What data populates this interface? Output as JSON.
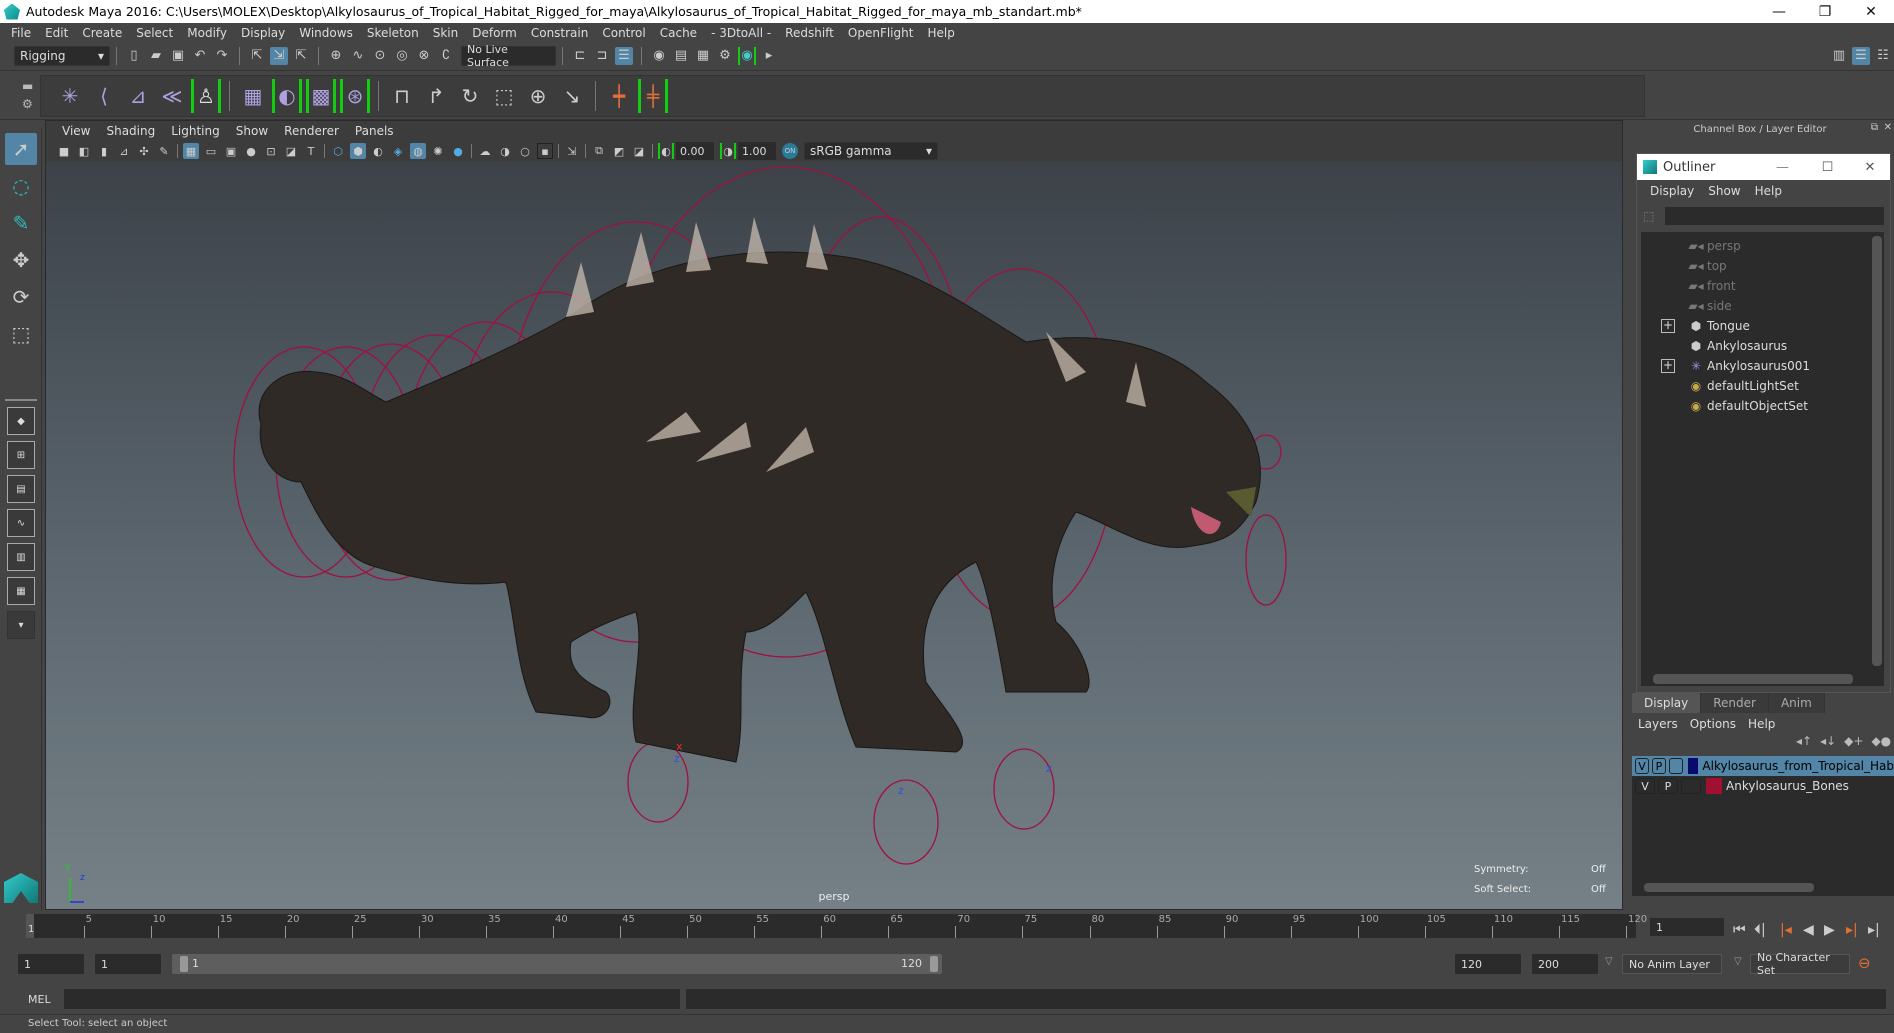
{
  "window": {
    "title": "Autodesk Maya 2016: C:\\Users\\MOLEX\\Desktop\\Alkylosaurus_of_Tropical_Habitat_Rigged_for_maya\\Alkylosaurus_of_Tropical_Habitat_Rigged_for_maya_mb_standart.mb*",
    "minimize": "—",
    "restore": "❐",
    "close": "✕"
  },
  "menubar": [
    "File",
    "Edit",
    "Create",
    "Select",
    "Modify",
    "Display",
    "Windows",
    "Skeleton",
    "Skin",
    "Deform",
    "Constrain",
    "Control",
    "Cache",
    "- 3DtoAll -",
    "Redshift",
    "OpenFlight",
    "Help"
  ],
  "statusline": {
    "menuset": "Rigging",
    "live_surface": "No Live Surface"
  },
  "viewport": {
    "menus": [
      "View",
      "Shading",
      "Lighting",
      "Show",
      "Renderer",
      "Panels"
    ],
    "exposure": "0.00",
    "gamma": "1.00",
    "color_space": "sRGB gamma",
    "camera_label": "persp",
    "hud": {
      "symmetry_label": "Symmetry:",
      "symmetry_value": "Off",
      "soft_select_label": "Soft Select:",
      "soft_select_value": "Off"
    },
    "axis": {
      "y": "y",
      "z": "z"
    }
  },
  "channel_box": {
    "title": "Channel Box / Layer Editor"
  },
  "outliner": {
    "title": "Outliner",
    "menus": [
      "Display",
      "Show",
      "Help"
    ],
    "search_value": "",
    "items": [
      {
        "label": "persp",
        "icon": "camera-icon",
        "dim": true,
        "expandable": false
      },
      {
        "label": "top",
        "icon": "camera-icon",
        "dim": true,
        "expandable": false
      },
      {
        "label": "front",
        "icon": "camera-icon",
        "dim": true,
        "expandable": false
      },
      {
        "label": "side",
        "icon": "camera-icon",
        "dim": true,
        "expandable": false
      },
      {
        "label": "Tongue",
        "icon": "mesh-icon",
        "dim": false,
        "expandable": true
      },
      {
        "label": "Ankylosaurus",
        "icon": "mesh-icon",
        "dim": false,
        "expandable": false
      },
      {
        "label": "Ankylosaurus001",
        "icon": "joint-icon",
        "dim": false,
        "expandable": true
      },
      {
        "label": "defaultLightSet",
        "icon": "set-icon",
        "dim": false,
        "expandable": false
      },
      {
        "label": "defaultObjectSet",
        "icon": "set-icon",
        "dim": false,
        "expandable": false
      }
    ]
  },
  "layer_editor": {
    "tabs": [
      "Display",
      "Render",
      "Anim"
    ],
    "active_tab": "Display",
    "menus": [
      "Layers",
      "Options",
      "Help"
    ],
    "layers": [
      {
        "v": "V",
        "p": "P",
        "name": "Alkylosaurus_from_Tropical_Hab",
        "color": "#0a0a6e",
        "selected": true
      },
      {
        "v": "V",
        "p": "P",
        "name": "Ankylosaurus_Bones",
        "color": "#a01030",
        "selected": false
      }
    ]
  },
  "timeline": {
    "ticks": [
      "5",
      "10",
      "15",
      "20",
      "25",
      "30",
      "35",
      "40",
      "45",
      "50",
      "55",
      "60",
      "65",
      "70",
      "75",
      "80",
      "85",
      "90",
      "95",
      "100",
      "105",
      "110",
      "115",
      "120"
    ],
    "current_frame_marker": "1",
    "current_frame": "1"
  },
  "range": {
    "start": "1",
    "playback_start": "1",
    "slider_start": "1",
    "slider_end": "120",
    "playback_end": "120",
    "end": "200",
    "anim_layer": "No Anim Layer",
    "character_set": "No Character Set"
  },
  "command_line": {
    "label": "MEL",
    "value": ""
  },
  "help_line": "Select Tool: select an object"
}
